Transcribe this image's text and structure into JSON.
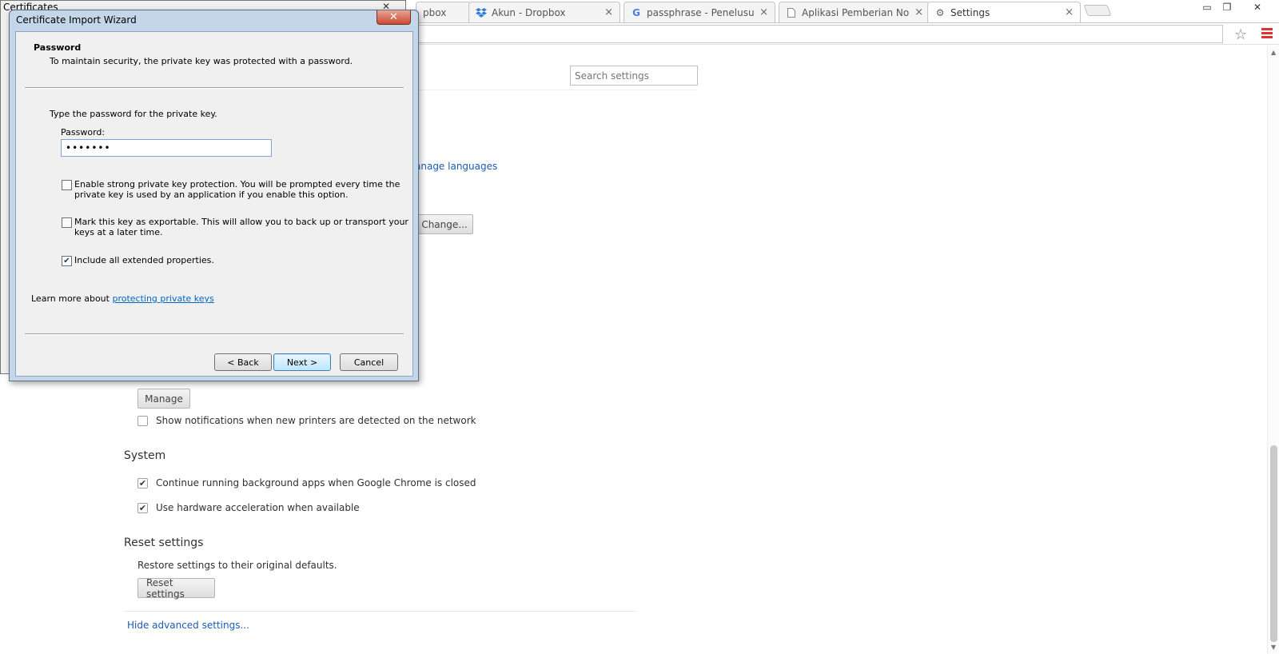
{
  "browser": {
    "tabs": [
      {
        "title": "pbox",
        "icon": ""
      },
      {
        "title": "Akun - Dropbox",
        "icon": "dropbox-icon"
      },
      {
        "title": "passphrase - Penelusuran",
        "icon": "google-icon"
      },
      {
        "title": "Aplikasi Pemberian Nomo",
        "icon": "page-icon"
      },
      {
        "title": "Settings",
        "icon": "gear-icon"
      }
    ],
    "tab_close": "×",
    "star": "☆"
  },
  "settings": {
    "search_placeholder": "Search settings",
    "manage_languages": "anage languages",
    "change_button": "Change...",
    "manage_button": "Manage",
    "printer_notify": "Show notifications when new printers are detected on the network",
    "system_title": "System",
    "background_apps": "Continue running background apps when Google Chrome is closed",
    "hardware_accel": "Use hardware acceleration when available",
    "reset_title": "Reset settings",
    "reset_desc": "Restore settings to their original defaults.",
    "reset_button": "Reset settings",
    "hide_advanced": "Hide advanced settings..."
  },
  "certificates": {
    "title": "Certificates"
  },
  "wizard": {
    "title": "Certificate Import Wizard",
    "heading": "Password",
    "subheading": "To maintain security, the private key was protected with a password.",
    "instruction": "Type the password for the private key.",
    "password_label": "Password:",
    "password_value": "•••••••",
    "strong_protection_line1": "Enable strong private key protection. You will be prompted every time the",
    "strong_protection_line2": "private key is used by an application if you enable this option.",
    "strong_protection_checked": false,
    "exportable_line1": "Mark this key as exportable. This will allow you to back up or transport your",
    "exportable_line2": "keys at a later time.",
    "exportable_checked": false,
    "extended_props": "Include all extended properties.",
    "extended_props_checked": true,
    "learn_more_prefix": "Learn more about",
    "learn_more_link": "protecting private keys",
    "back_button": "< Back",
    "next_button": "Next >",
    "cancel_button": "Cancel"
  }
}
